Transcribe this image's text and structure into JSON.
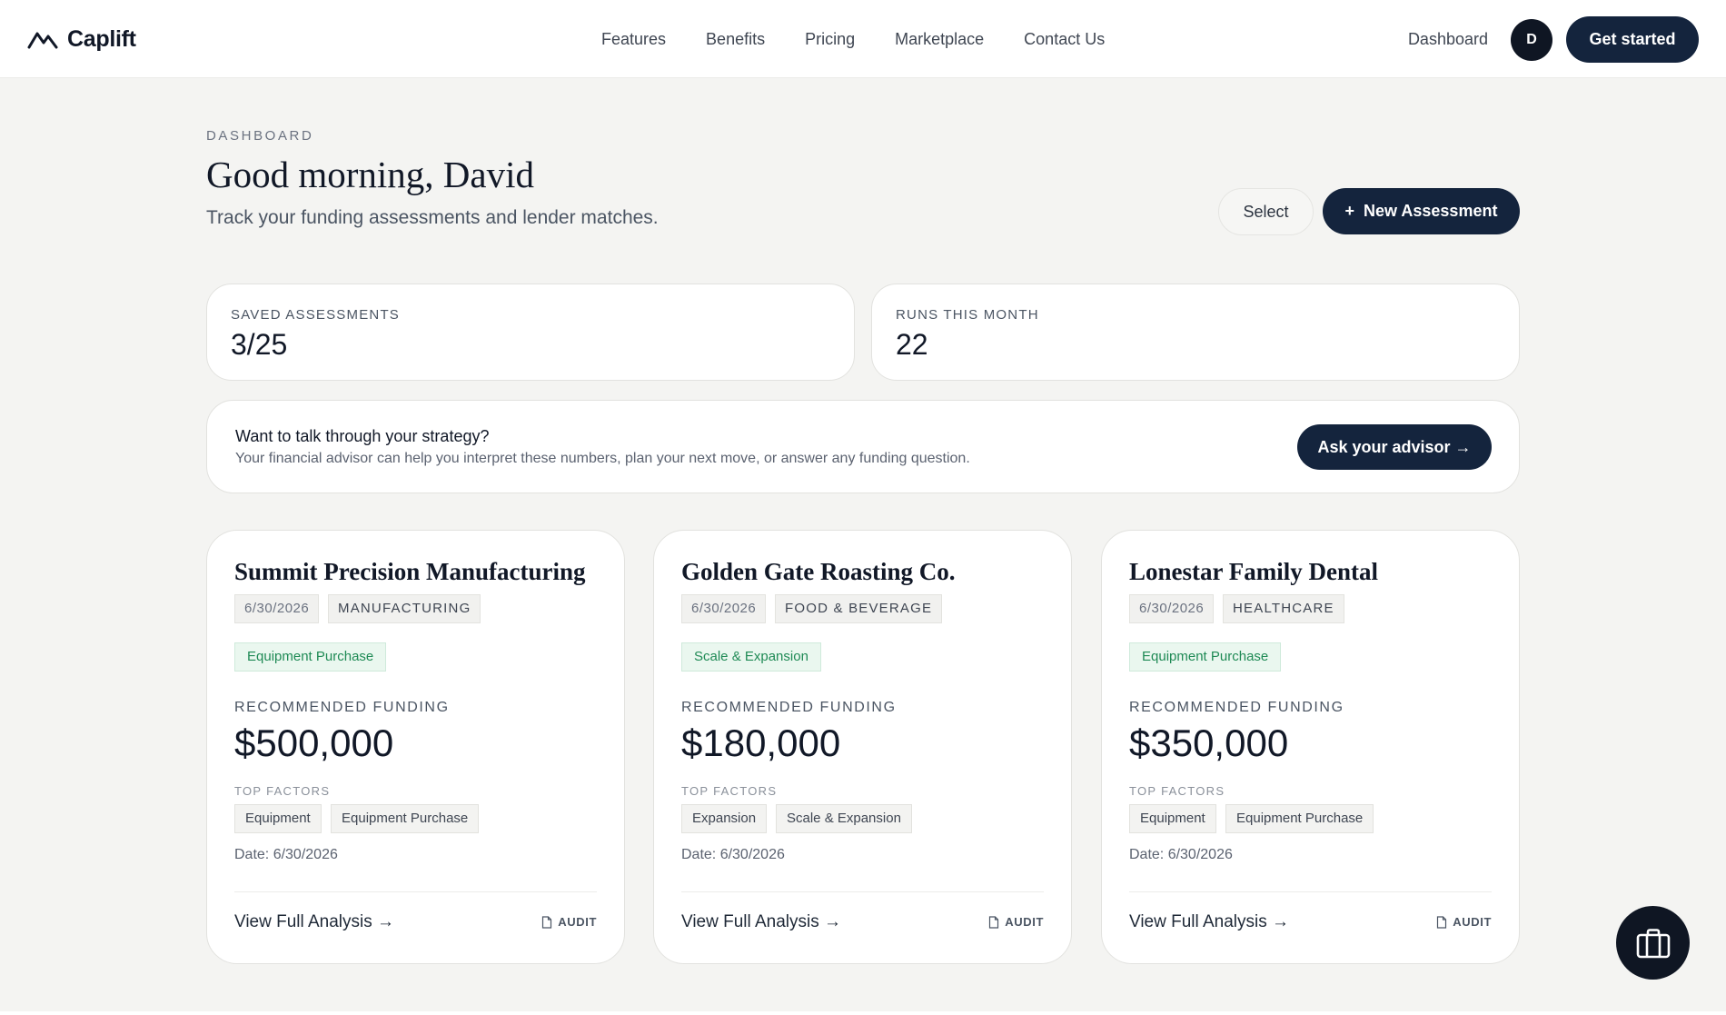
{
  "header": {
    "brand": "Caplift",
    "nav": [
      "Features",
      "Benefits",
      "Pricing",
      "Marketplace",
      "Contact Us"
    ],
    "dashboard_link": "Dashboard",
    "avatar_initial": "D",
    "cta": "Get started"
  },
  "page": {
    "eyebrow": "DASHBOARD",
    "greeting": "Good morning, David",
    "subtitle": "Track your funding assessments and lender matches.",
    "select_label": "Select",
    "new_plus": "+",
    "new_label": "New Assessment"
  },
  "stats": [
    {
      "label": "SAVED ASSESSMENTS",
      "value": "3/25"
    },
    {
      "label": "RUNS THIS MONTH",
      "value": "22"
    }
  ],
  "advisor": {
    "title": "Want to talk through your strategy?",
    "text": "Your financial advisor can help you interpret these numbers, plan your next move, or answer any funding question.",
    "button": "Ask your advisor →"
  },
  "cards": [
    {
      "title": "Summit Precision Manufacturing",
      "date_tag": "6/30/2026",
      "category": "MANUFACTURING",
      "purpose": "Equipment Purchase",
      "funding_label": "RECOMMENDED FUNDING",
      "funding": "$500,000",
      "factors_label": "TOP FACTORS",
      "factors": [
        "Equipment",
        "Equipment Purchase"
      ],
      "date": "Date: 6/30/2026",
      "view": "View Full Analysis →",
      "audit": "AUDIT"
    },
    {
      "title": "Golden Gate Roasting Co.",
      "date_tag": "6/30/2026",
      "category": "FOOD & BEVERAGE",
      "purpose": "Scale & Expansion",
      "funding_label": "RECOMMENDED FUNDING",
      "funding": "$180,000",
      "factors_label": "TOP FACTORS",
      "factors": [
        "Expansion",
        "Scale & Expansion"
      ],
      "date": "Date: 6/30/2026",
      "view": "View Full Analysis →",
      "audit": "AUDIT"
    },
    {
      "title": "Lonestar Family Dental",
      "date_tag": "6/30/2026",
      "category": "HEALTHCARE",
      "purpose": "Equipment Purchase",
      "funding_label": "RECOMMENDED FUNDING",
      "funding": "$350,000",
      "factors_label": "TOP FACTORS",
      "factors": [
        "Equipment",
        "Equipment Purchase"
      ],
      "date": "Date: 6/30/2026",
      "view": "View Full Analysis →",
      "audit": "AUDIT"
    }
  ],
  "icons": {
    "logo": "mountain-logo-icon",
    "audit": "document-icon",
    "fab": "briefcase-icon"
  },
  "colors": {
    "primary": "#14243d",
    "background": "#f4f4f2",
    "purpose_tag_text": "#1f8a55",
    "purpose_tag_bg": "#eaf7ef"
  }
}
